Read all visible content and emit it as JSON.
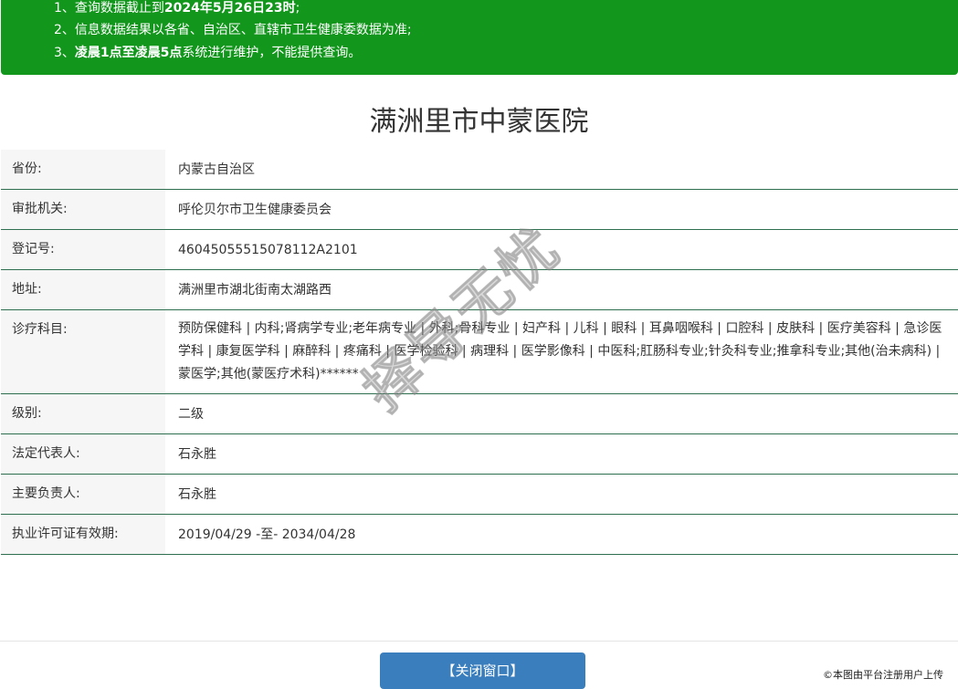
{
  "notice": {
    "line1_prefix": "1、查询数据截止到",
    "line1_bold": "2024年5月26日23时",
    "line1_suffix": ";",
    "line2": "2、信息数据结果以各省、自治区、直辖市卫生健康委数据为准;",
    "line3_prefix": "3、",
    "line3_bold": "凌晨1点至凌晨5点",
    "line3_suffix": "系统进行维护，不能提供查询。"
  },
  "title": "满洲里市中蒙医院",
  "rows": [
    {
      "label": "省份:",
      "value": "内蒙古自治区"
    },
    {
      "label": "审批机关:",
      "value": "呼伦贝尔市卫生健康委员会"
    },
    {
      "label": "登记号:",
      "value": "46045055515078112A2101"
    },
    {
      "label": "地址:",
      "value": "满洲里市湖北街南太湖路西"
    },
    {
      "label": "诊疗科目:",
      "value": "预防保健科 | 内科;肾病学专业;老年病专业 | 外科;骨科专业 | 妇产科 | 儿科 | 眼科 | 耳鼻咽喉科 | 口腔科 | 皮肤科 | 医疗美容科 | 急诊医学科 | 康复医学科 | 麻醉科 | 疼痛科 | 医学检验科 | 病理科 | 医学影像科 | 中医科;肛肠科专业;针灸科专业;推拿科专业;其他(治未病科) | 蒙医学;其他(蒙医疗术科)******"
    },
    {
      "label": "级别:",
      "value": "二级"
    },
    {
      "label": "法定代表人:",
      "value": "石永胜"
    },
    {
      "label": "主要负责人:",
      "value": "石永胜"
    },
    {
      "label": "执业许可证有效期:",
      "value": "2019/04/29 -至- 2034/04/28"
    }
  ],
  "close_button": "【关闭窗口】",
  "copyright": "©本图由平台注册用户上传",
  "watermark": "择导无忧"
}
